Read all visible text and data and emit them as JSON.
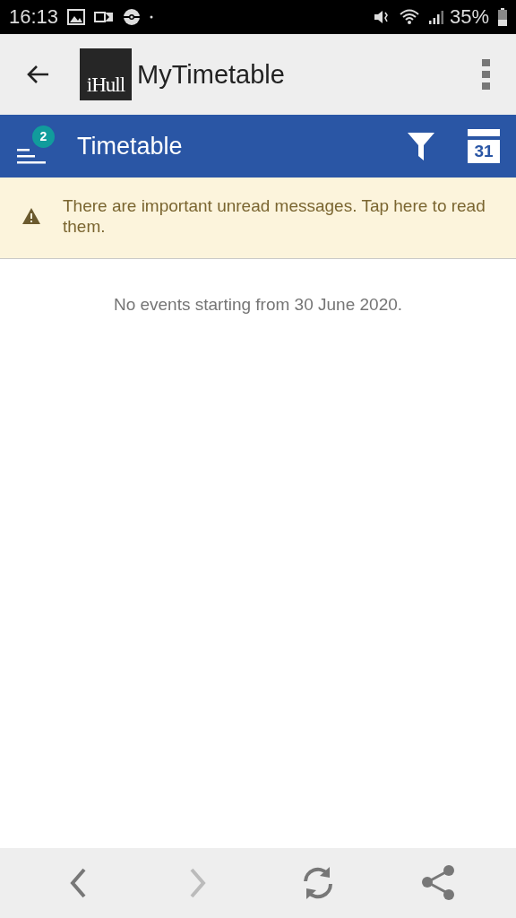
{
  "status_bar": {
    "time": "16:13",
    "battery": "35%"
  },
  "app_bar": {
    "logo": "iHull",
    "title": "MyTimetable"
  },
  "toolbar": {
    "badge": "2",
    "title": "Timetable",
    "calendar_day": "31"
  },
  "banner": {
    "text": "There are important unread messages. Tap here to read them."
  },
  "empty_message": "No events starting from 30 June 2020.",
  "bottom_nav": [
    {
      "kind": "back",
      "disabled": false
    },
    {
      "kind": "forward",
      "disabled": true
    },
    {
      "kind": "refresh",
      "disabled": false
    },
    {
      "kind": "share",
      "disabled": false
    }
  ]
}
